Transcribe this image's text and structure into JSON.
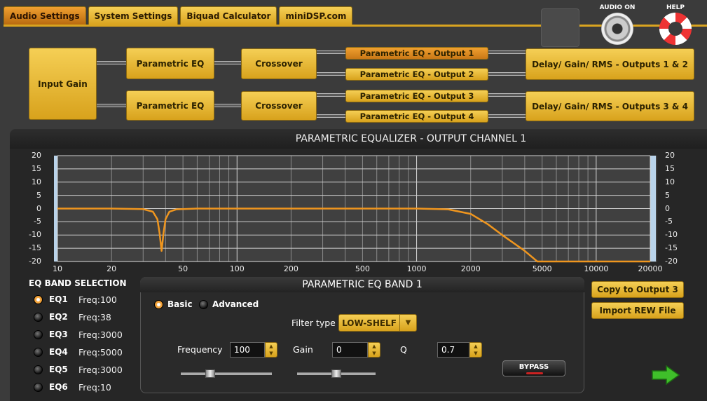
{
  "tabs": [
    {
      "label": "Audio Settings",
      "active": true
    },
    {
      "label": "System Settings",
      "active": false
    },
    {
      "label": "Biquad Calculator",
      "active": false
    },
    {
      "label": "miniDSP.com",
      "active": false
    }
  ],
  "top_icons": {
    "audio_on_label": "AUDIO ON",
    "audio_on_icon": "speaker-icon",
    "help_label": "HELP",
    "help_icon": "lifebuoy-icon"
  },
  "diagram": {
    "input_gain": "Input Gain",
    "peq_1": "Parametric EQ",
    "peq_2": "Parametric EQ",
    "crossover_1": "Crossover",
    "crossover_2": "Crossover",
    "outputs": [
      "Parametric EQ - Output 1",
      "Parametric EQ - Output 2",
      "Parametric EQ - Output 3",
      "Parametric EQ - Output 4"
    ],
    "delay_1": "Delay/ Gain/ RMS - Outputs 1 & 2",
    "delay_2": "Delay/ Gain/ RMS - Outputs 3 & 4",
    "selected_output": 1
  },
  "panel_title": "PARAMETRIC EQUALIZER - OUTPUT CHANNEL 1",
  "chart_data": {
    "type": "line",
    "title": "",
    "xscale": "log",
    "xlim": [
      10,
      20000
    ],
    "ylim": [
      -20,
      20
    ],
    "x_ticks": [
      "10",
      "20",
      "50",
      "100",
      "200",
      "500",
      "1000",
      "2000",
      "5000",
      "10000",
      "20000"
    ],
    "y_ticks": [
      "20",
      "15",
      "10",
      "5",
      "0",
      "-5",
      "-10",
      "-15",
      "-20"
    ],
    "grid": true,
    "series": [
      {
        "color": "#f0961e",
        "x": [
          10,
          20,
          30,
          34,
          36,
          37,
          38,
          39,
          40,
          42,
          46,
          60,
          100,
          500,
          1000,
          1500,
          2000,
          2500,
          3000,
          4000,
          4700,
          5000,
          10000,
          20000
        ],
        "y": [
          0,
          0,
          -0.2,
          -1.2,
          -4,
          -9,
          -16,
          -9,
          -4,
          -1.2,
          -0.3,
          0,
          0,
          0,
          0,
          -0.3,
          -2,
          -6,
          -10,
          -16,
          -20,
          -20,
          -20,
          -20
        ]
      }
    ]
  },
  "band_selection": {
    "title": "EQ BAND SELECTION",
    "bands": [
      {
        "name": "EQ1",
        "freq": "Freq:100",
        "selected": true
      },
      {
        "name": "EQ2",
        "freq": "Freq:38",
        "selected": false
      },
      {
        "name": "EQ3",
        "freq": "Freq:3000",
        "selected": false
      },
      {
        "name": "EQ4",
        "freq": "Freq:5000",
        "selected": false
      },
      {
        "name": "EQ5",
        "freq": "Freq:3000",
        "selected": false
      },
      {
        "name": "EQ6",
        "freq": "Freq:10",
        "selected": false
      }
    ]
  },
  "peq_band": {
    "title": "PARAMETRIC EQ BAND 1",
    "mode_basic": "Basic",
    "mode_advanced": "Advanced",
    "mode_selected": "Basic",
    "filter_type_label": "Filter type",
    "filter_type_value": "LOW-SHELF",
    "frequency_label": "Frequency",
    "frequency_value": "100",
    "gain_label": "Gain",
    "gain_value": "0",
    "q_label": "Q",
    "q_value": "0.7",
    "frequency_slider_level": 0.3,
    "gain_slider_level": 0.5,
    "bypass_label": "BYPASS"
  },
  "side_buttons": {
    "copy": "Copy to Output 3",
    "import": "Import REW File"
  }
}
